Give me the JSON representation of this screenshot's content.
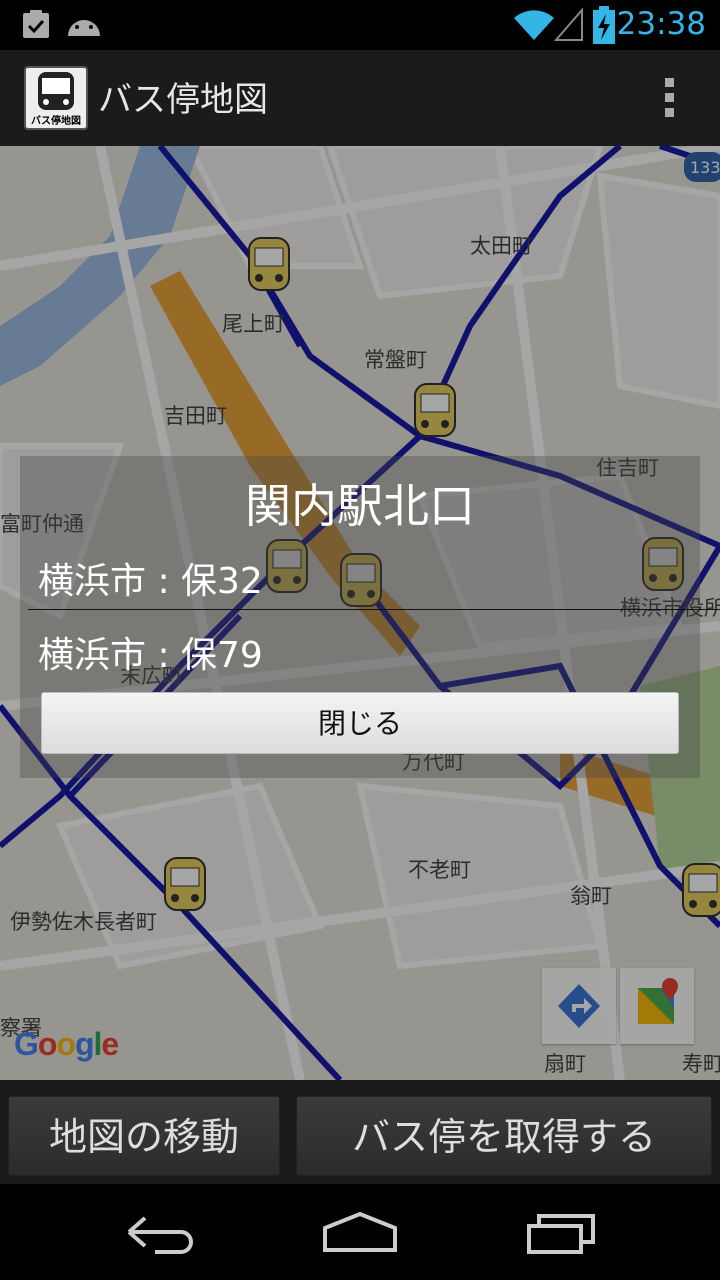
{
  "status_bar": {
    "time": "23:38",
    "icons": [
      "clipboard-check-icon",
      "android-icon",
      "wifi-icon",
      "signal-icon",
      "battery-charging-icon"
    ]
  },
  "action_bar": {
    "app_icon_label": "バス停地図",
    "title": "バス停地図",
    "overflow_icon": "overflow-menu-icon"
  },
  "map": {
    "labels": [
      "太田町",
      "尾上町",
      "常盤町",
      "吉田町",
      "住吉町",
      "富町仲通",
      "横浜市役所",
      "末広町",
      "万代町",
      "不老町",
      "翁町",
      "伊勢佐木長者町",
      "寿町",
      "察署",
      "扇町"
    ],
    "shield_number": "133",
    "provider": "Google",
    "tools": [
      "directions-icon",
      "google-maps-icon"
    ]
  },
  "dialog": {
    "title": "関内駅北口",
    "items": [
      "横浜市 : 保32",
      "横浜市 : 保79"
    ],
    "close_label": "閉じる"
  },
  "buttons": {
    "move_map": "地図の移動",
    "get_stops": "バス停を取得する"
  },
  "nav": [
    "back-icon",
    "home-icon",
    "recent-apps-icon"
  ],
  "colors": {
    "accent": "#33b5e5",
    "route_line": "#1a1aa8",
    "bus_icon": "#e8d060",
    "actionbar": "#1b1b1b"
  }
}
